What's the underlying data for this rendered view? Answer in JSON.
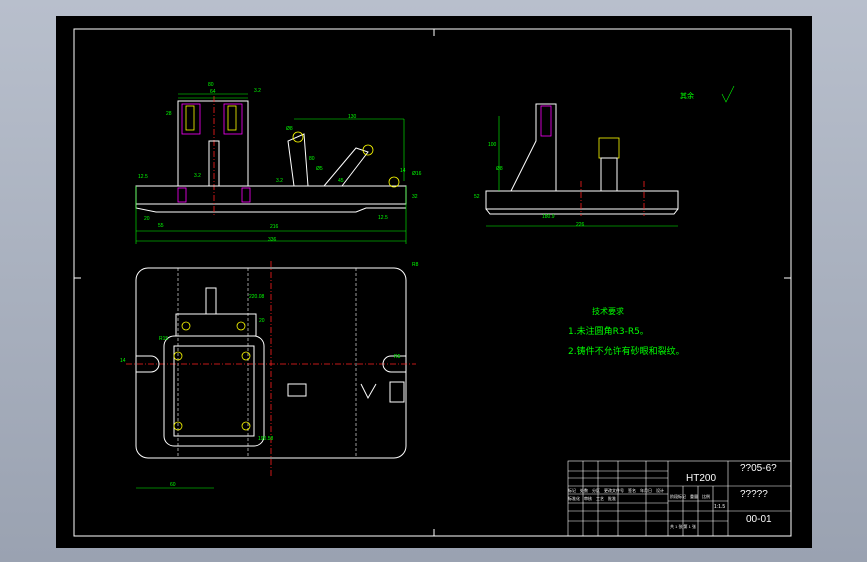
{
  "title_block": {
    "material": "HT200",
    "drawing_no": "??05-6?",
    "name": "?????",
    "code": "00-01",
    "scale": "1:1.5",
    "cells": [
      "标记",
      "处数",
      "分区",
      "更改文件号",
      "签名",
      "年月日",
      "设计",
      "标准化",
      "审核",
      "工艺",
      "批准",
      "阶段标记",
      "重量",
      "比例",
      "共 1 张 第 1 张"
    ]
  },
  "notes": {
    "heading": "技术要求",
    "lines": [
      "1.未注圆角R3-R5。",
      "2.铸件不允许有砂眼和裂纹。"
    ]
  },
  "roughness_symbol": "其余",
  "dimensions": {
    "front": [
      "80",
      "64",
      "3.2",
      "28",
      "130",
      "Ø8",
      "3.2",
      "12.5",
      "3.2",
      "Ø5",
      "20",
      "55",
      "216",
      "336",
      "80",
      "14",
      "Ø16",
      "32",
      "12.5",
      "45"
    ],
    "side": [
      "100",
      "Ø8",
      "180.9",
      "226",
      "52"
    ],
    "plan": [
      "R8",
      "220.08",
      "20",
      "R15",
      "14",
      "R5",
      "190.58",
      "60"
    ]
  }
}
